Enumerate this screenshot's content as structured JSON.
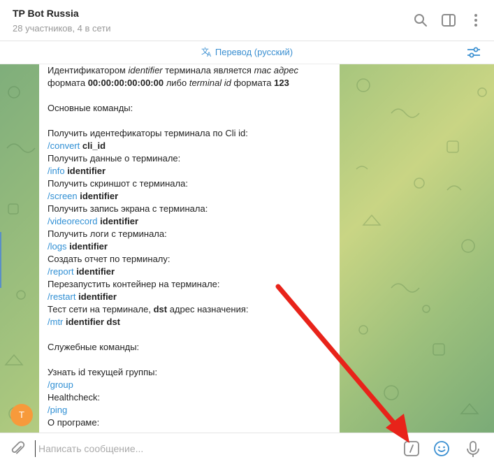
{
  "header": {
    "title": "TP Bot Russia",
    "subtitle": "28 участников, 4 в сети"
  },
  "translate": {
    "label": "Перевод (русский)"
  },
  "avatar": {
    "initial": "T",
    "color": "#f79a3b"
  },
  "message": {
    "lines": [
      {
        "parts": [
          {
            "t": "Идентификатором "
          },
          {
            "t": "identifier",
            "i": true
          },
          {
            "t": " терминала является "
          },
          {
            "t": "mac адрес",
            "i": true
          }
        ]
      },
      {
        "parts": [
          {
            "t": "формата "
          },
          {
            "t": "00:00:00:00:00:00",
            "b": true
          },
          {
            "t": " либо "
          },
          {
            "t": "terminal id",
            "i": true
          },
          {
            "t": " формата "
          },
          {
            "t": "123",
            "b": true
          }
        ]
      },
      {
        "parts": []
      },
      {
        "parts": [
          {
            "t": "Основные команды:"
          }
        ]
      },
      {
        "parts": []
      },
      {
        "parts": [
          {
            "t": "Получить идентефикаторы терминала по Cli id:"
          }
        ]
      },
      {
        "parts": [
          {
            "t": "/convert",
            "c": true
          },
          {
            "t": " cli_id",
            "b": true
          }
        ]
      },
      {
        "parts": [
          {
            "t": "Получить данные о терминале:"
          }
        ]
      },
      {
        "parts": [
          {
            "t": "/info",
            "c": true
          },
          {
            "t": " identifier",
            "b": true
          }
        ]
      },
      {
        "parts": [
          {
            "t": "Получить скриншот с терминала:"
          }
        ]
      },
      {
        "parts": [
          {
            "t": "/screen",
            "c": true
          },
          {
            "t": " identifier",
            "b": true
          }
        ]
      },
      {
        "parts": [
          {
            "t": "Получить запись экрана с терминала:"
          }
        ]
      },
      {
        "parts": [
          {
            "t": "/videorecord",
            "c": true
          },
          {
            "t": " identifier",
            "b": true
          }
        ]
      },
      {
        "parts": [
          {
            "t": "Получить логи с терминала:"
          }
        ]
      },
      {
        "parts": [
          {
            "t": "/logs",
            "c": true
          },
          {
            "t": " identifier",
            "b": true
          }
        ]
      },
      {
        "parts": [
          {
            "t": "Создать отчет по терминалу:"
          }
        ]
      },
      {
        "parts": [
          {
            "t": "/report",
            "c": true
          },
          {
            "t": " identifier",
            "b": true
          }
        ]
      },
      {
        "parts": [
          {
            "t": "Перезапустить контейнер на терминале:"
          }
        ]
      },
      {
        "parts": [
          {
            "t": "/restart",
            "c": true
          },
          {
            "t": " identifier",
            "b": true
          }
        ]
      },
      {
        "parts": [
          {
            "t": "Тест сети на терминале, "
          },
          {
            "t": "dst",
            "b": true
          },
          {
            "t": " адрес назначения:"
          }
        ]
      },
      {
        "parts": [
          {
            "t": "/mtr",
            "c": true
          },
          {
            "t": " identifier dst",
            "b": true
          }
        ]
      },
      {
        "parts": []
      },
      {
        "parts": [
          {
            "t": "Служебные команды:"
          }
        ]
      },
      {
        "parts": []
      },
      {
        "parts": [
          {
            "t": "Узнать id текущей группы:"
          }
        ]
      },
      {
        "parts": [
          {
            "t": "/group",
            "c": true
          }
        ]
      },
      {
        "parts": [
          {
            "t": "Healthcheck:"
          }
        ]
      },
      {
        "parts": [
          {
            "t": "/ping",
            "c": true
          }
        ]
      },
      {
        "parts": [
          {
            "t": "О програме:"
          }
        ]
      }
    ]
  },
  "composer": {
    "placeholder": "Написать сообщение...",
    "value": ""
  },
  "icons": {
    "search": "search-icon",
    "sidebar": "sidebar-toggle-icon",
    "more": "more-vertical-icon",
    "translate": "translate-icon",
    "settings": "translate-settings-icon",
    "attach": "paperclip-icon",
    "commands": "bot-commands-icon",
    "emoji": "emoji-icon",
    "mic": "microphone-icon"
  },
  "colors": {
    "accent": "#3a8fd1",
    "link": "#2f8fd4",
    "annotation_arrow": "#e8231a"
  }
}
